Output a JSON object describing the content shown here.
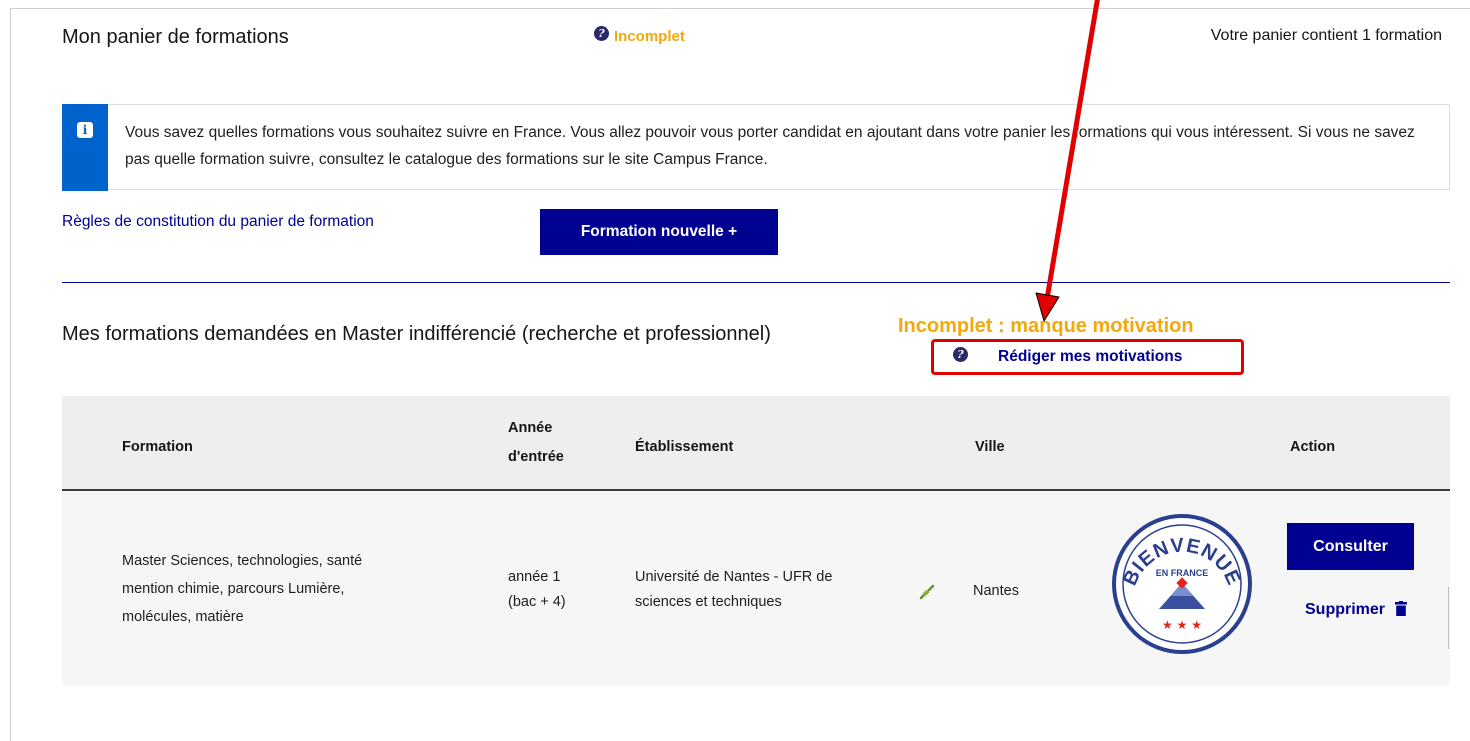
{
  "basket": {
    "title": "Mon panier de formations",
    "status": "Incomplet",
    "count_text": "Votre panier contient 1 formation"
  },
  "info": {
    "icon": "info-icon",
    "text": "Vous savez quelles formations vous souhaitez suivre en France. Vous allez pouvoir vous porter candidat en ajoutant dans votre panier les formations qui vous intéressent. Si vous ne savez pas quelle formation suivre, consultez le catalogue des formations sur le site Campus France."
  },
  "rules_link": "Règles de constitution du panier de formation",
  "new_button": "Formation nouvelle  +",
  "section": {
    "title": "Mes formations demandées en Master indifférencié (recherche et professionnel)",
    "status": "Incomplet : manque motivation",
    "motivation_link": "Rédiger mes motivations"
  },
  "table": {
    "headers": {
      "formation": "Formation",
      "year_line1": "Année",
      "year_line2": "d'entrée",
      "school": "Établissement",
      "city": "Ville",
      "action": "Action"
    },
    "rows": [
      {
        "formation_l1": "Master Sciences, technologies, santé",
        "formation_l2": "mention chimie, parcours Lumière,",
        "formation_l3": "molécules, matière",
        "year_l1": "année 1",
        "year_l2": "(bac + 4)",
        "school_l1": "Université de Nantes - UFR de",
        "school_l2": "sciences et techniques",
        "city": "Nantes",
        "logo_text": "BIENVENUE EN FRANCE",
        "consult": "Consulter",
        "delete": "Supprimer"
      }
    ]
  },
  "colors": {
    "primary": "#000091",
    "info": "#0063cb",
    "warning": "#f4a80c",
    "annotation": "#e00000"
  }
}
